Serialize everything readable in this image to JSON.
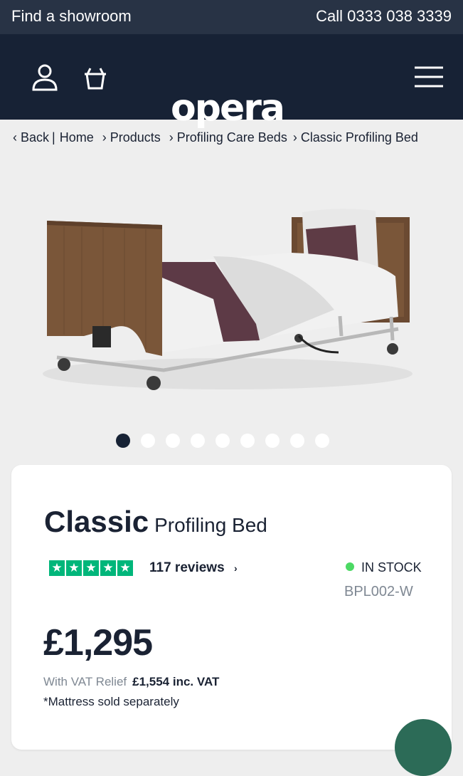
{
  "topbar": {
    "showroom": "Find a showroom",
    "call": "Call 0333 038 3339"
  },
  "header": {
    "logo_text": "opera",
    "icons": [
      "user-icon",
      "basket-icon",
      "menu-icon"
    ]
  },
  "breadcrumb": {
    "back": "‹  Back",
    "home": "Home",
    "items": [
      "› Products",
      "› Profiling Care Beds",
      "› Classic Profiling Bed"
    ]
  },
  "gallery": {
    "slides": 9,
    "active": 0
  },
  "product": {
    "title_bold": "Classic",
    "title_rest": "Profiling Bed",
    "rating_stars": 5,
    "reviews": "117 reviews",
    "stock": "IN STOCK",
    "sku": "BPL002-W",
    "price": "£1,295",
    "vat_label": "With VAT Relief",
    "vat_price": "£1,554 inc. VAT",
    "note": "*Mattress sold separately"
  },
  "colors": {
    "topbar": "#283345",
    "header": "#172235",
    "trustpilot": "#00b67a",
    "stock": "#4cd964"
  }
}
